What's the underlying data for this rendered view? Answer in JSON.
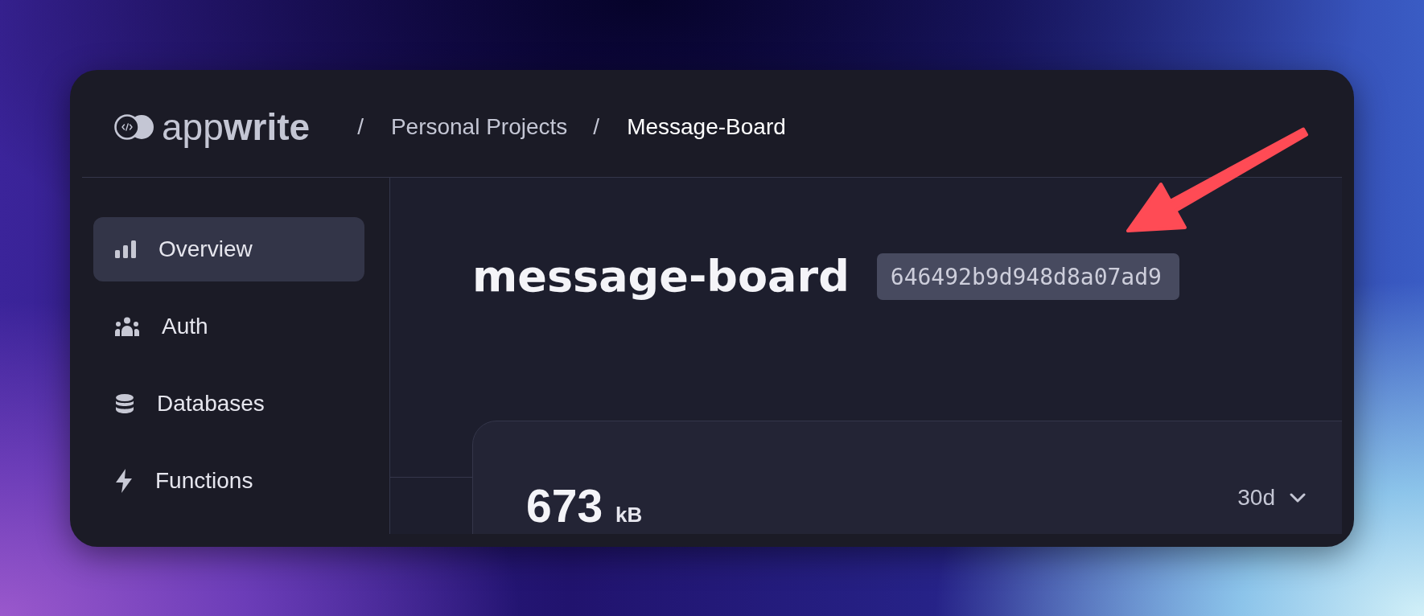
{
  "header": {
    "logo": "app**write**",
    "breadcrumbs": [
      {
        "separator": "/",
        "label": "Personal Projects",
        "current": false
      },
      {
        "separator": "/",
        "label": "Message-Board",
        "current": true
      }
    ]
  },
  "sidebar": {
    "items": [
      {
        "label": "Overview",
        "selected": true
      },
      {
        "label": "Auth",
        "selected": false
      },
      {
        "label": "Databases",
        "selected": false
      },
      {
        "label": "Functions",
        "selected": false
      }
    ]
  },
  "project": {
    "name": "message-board",
    "id": "646492b9d948d8a07ad9"
  },
  "usage_card": {
    "value": "673",
    "unit": "kB",
    "period": "30d"
  }
}
